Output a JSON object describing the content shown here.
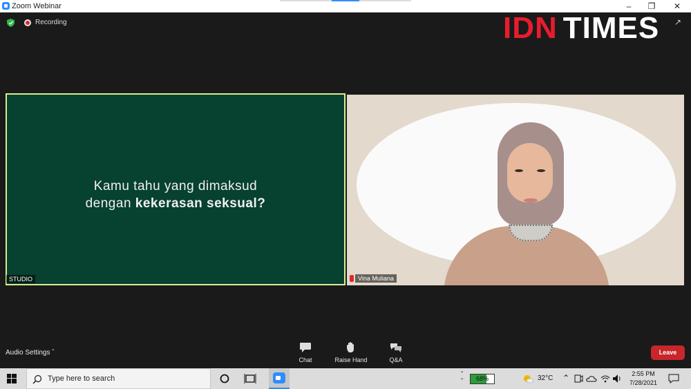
{
  "window": {
    "title": "Zoom Webinar"
  },
  "status": {
    "recording_label": "Recording"
  },
  "logo": {
    "part1": "IDN",
    "part2": "TIMES"
  },
  "slide": {
    "line1": "Kamu tahu yang dimaksud",
    "line2_prefix": "dengan ",
    "line2_bold": "kekerasan seksual?",
    "name_tag": "STUDIO"
  },
  "speaker": {
    "name": "Vina Muliana"
  },
  "toolbar": {
    "audio_settings": "Audio Settings",
    "chat": "Chat",
    "raise_hand": "Raise Hand",
    "qa": "Q&A",
    "leave": "Leave"
  },
  "taskbar": {
    "search_placeholder": "Type here to search",
    "battery_percent": "68%",
    "battery_level": 0.68,
    "temperature": "32°C",
    "time": "2:55 PM",
    "date": "7/28/2021"
  },
  "colors": {
    "slide_bg": "#07412f",
    "slide_border": "#d9ee8e",
    "logo_red": "#e81c2e",
    "leave_red": "#c8262b",
    "zoom_blue": "#2d8cff"
  }
}
